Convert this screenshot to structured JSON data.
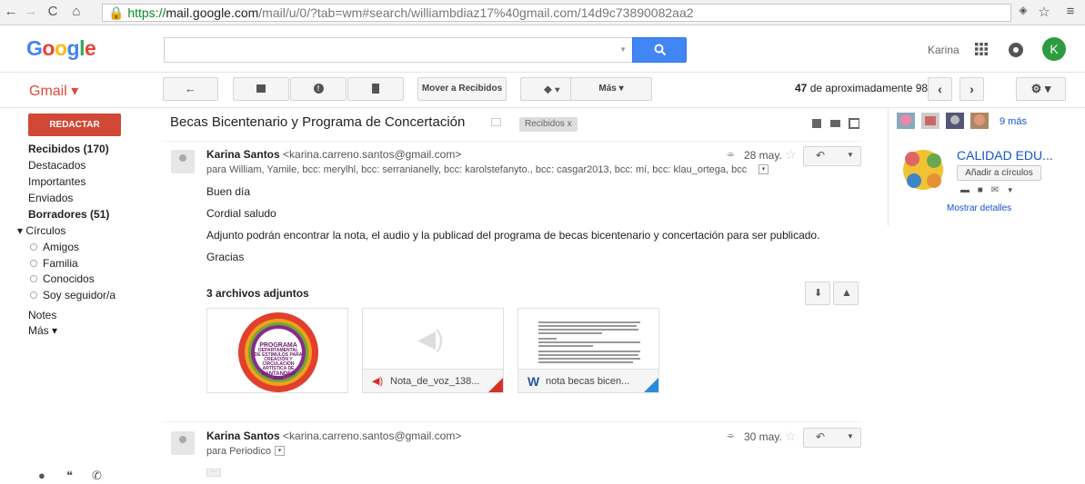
{
  "browser": {
    "url_prefix": "https://",
    "url_domain": "mail.google.com",
    "url_path": "/mail/u/0/?tab=wm#search/williambdiaz17%40gmail.com/14d9c73890082aa2"
  },
  "header": {
    "logo": "Google",
    "search_placeholder": "",
    "user_name": "Karina",
    "avatar_letter": "K"
  },
  "toolbar": {
    "app_label": "Gmail ▾",
    "move_to_inbox": "Mover a Recibidos",
    "more": "Más ▾",
    "count_number": "47",
    "count_text": " de aproximadamente 98"
  },
  "sidebar": {
    "compose": "REDACTAR",
    "items": [
      {
        "label": "Recibidos (170)",
        "bold": true
      },
      {
        "label": "Destacados",
        "bold": false
      },
      {
        "label": "Importantes",
        "bold": false
      },
      {
        "label": "Enviados",
        "bold": false
      },
      {
        "label": "Borradores (51)",
        "bold": true
      }
    ],
    "circles_label": "▾ Círculos",
    "circles": [
      "Amigos",
      "Familia",
      "Conocidos",
      "Soy seguidor/a"
    ],
    "notes": "Notes",
    "more": "Más ▾"
  },
  "thread": {
    "subject": "Becas Bicentenario y Programa de Concertación",
    "label_chip": "Recibidos   x"
  },
  "messages": [
    {
      "sender_name": "Karina Santos",
      "sender_email": "<karina.carreno.santos@gmail.com>",
      "recipients": "para William, Yamile, bcc: merylhl, bcc: serranianelly, bcc: karolstefanyto., bcc: casgar2013, bcc: mí, bcc: klau_ortega, bcc",
      "date": "28 may.",
      "body": [
        "Buen día",
        "Cordial saludo",
        "Adjunto podrán encontrar la nota, el audio y la publicad del programa de becas bicentenario y concertación para ser publicado.",
        "Gracias"
      ]
    },
    {
      "sender_name": "Karina Santos",
      "sender_email": "<karina.carreno.santos@gmail.com>",
      "recipients": "para Periodico",
      "date": "30 may."
    }
  ],
  "attachments": {
    "heading": "3 archivos adjuntos",
    "files": [
      {
        "name": "",
        "poster_lines": [
          "PROGRAMA",
          "DEPARTAMENTAL",
          "DE ESTIMULOS PARA",
          "CREACIÓN Y CIRCULACIÓN",
          "ARTÍSTICA DE",
          "SANTANDER",
          "2015"
        ]
      },
      {
        "name": "Nota_de_voz_138..."
      },
      {
        "name": "nota becas bicen..."
      }
    ]
  },
  "right_panel": {
    "more_people": "9 más",
    "contact_name": "CALIDAD EDU...",
    "add_circles": "Añadir a círculos",
    "show_details": "Mostrar detalles"
  },
  "colors": {
    "compose": "#d14836",
    "search_button": "#4285f4",
    "avatar": "#2e9b40",
    "link": "#1155cc"
  }
}
